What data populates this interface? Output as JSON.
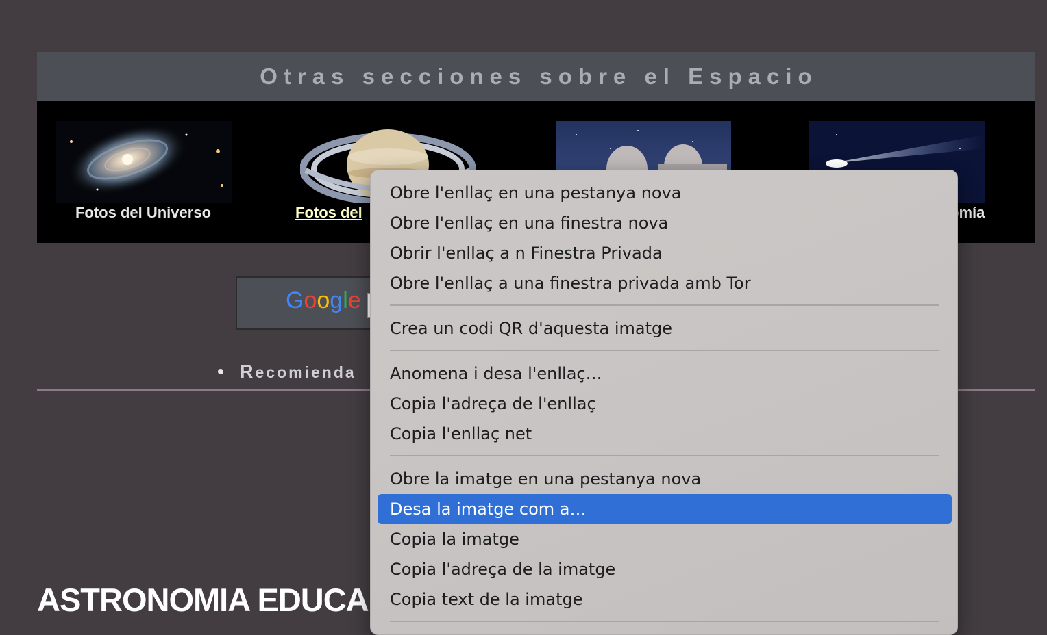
{
  "section": {
    "title": "Otras secciones sobre el Espacio",
    "items": [
      {
        "label": "Fotos del Universo",
        "image": "galaxy-thumbnail"
      },
      {
        "label": "Fotos del",
        "image": "saturn-thumbnail"
      },
      {
        "label": "",
        "image": "observatory-thumbnail"
      },
      {
        "label": "omía",
        "image": "comet-thumbnail"
      }
    ]
  },
  "search": {
    "logo": "Google"
  },
  "recommend": {
    "first_letter": "R",
    "rest": "ecomienda"
  },
  "page": {
    "bottom_title": "ASTRONOMIA EDUCA"
  },
  "context_menu": {
    "items": [
      {
        "label": "Obre l'enllaç en una pestanya nova"
      },
      {
        "label": "Obre l'enllaç en una finestra nova"
      },
      {
        "label": "Obrir l'enllaç a n Finestra Privada"
      },
      {
        "label": "Obre l'enllaç a una finestra privada amb Tor"
      },
      {
        "label": "Crea un codi QR d'aquesta imatge"
      },
      {
        "label": "Anomena i desa l'enllaç…"
      },
      {
        "label": "Copia l'adreça de l'enllaç"
      },
      {
        "label": "Copia l'enllaç net"
      },
      {
        "label": "Obre la imatge en una pestanya nova"
      },
      {
        "label": "Desa la imatge com a…",
        "highlighted": true
      },
      {
        "label": "Copia la imatge"
      },
      {
        "label": "Copia l'adreça de la imatge"
      },
      {
        "label": "Copia text de la imatge"
      }
    ]
  },
  "colors": {
    "background": "#433d41",
    "header_bar": "#4c4f56",
    "menu_highlight": "#2f6fd6",
    "link_active": "#ffffc8"
  }
}
